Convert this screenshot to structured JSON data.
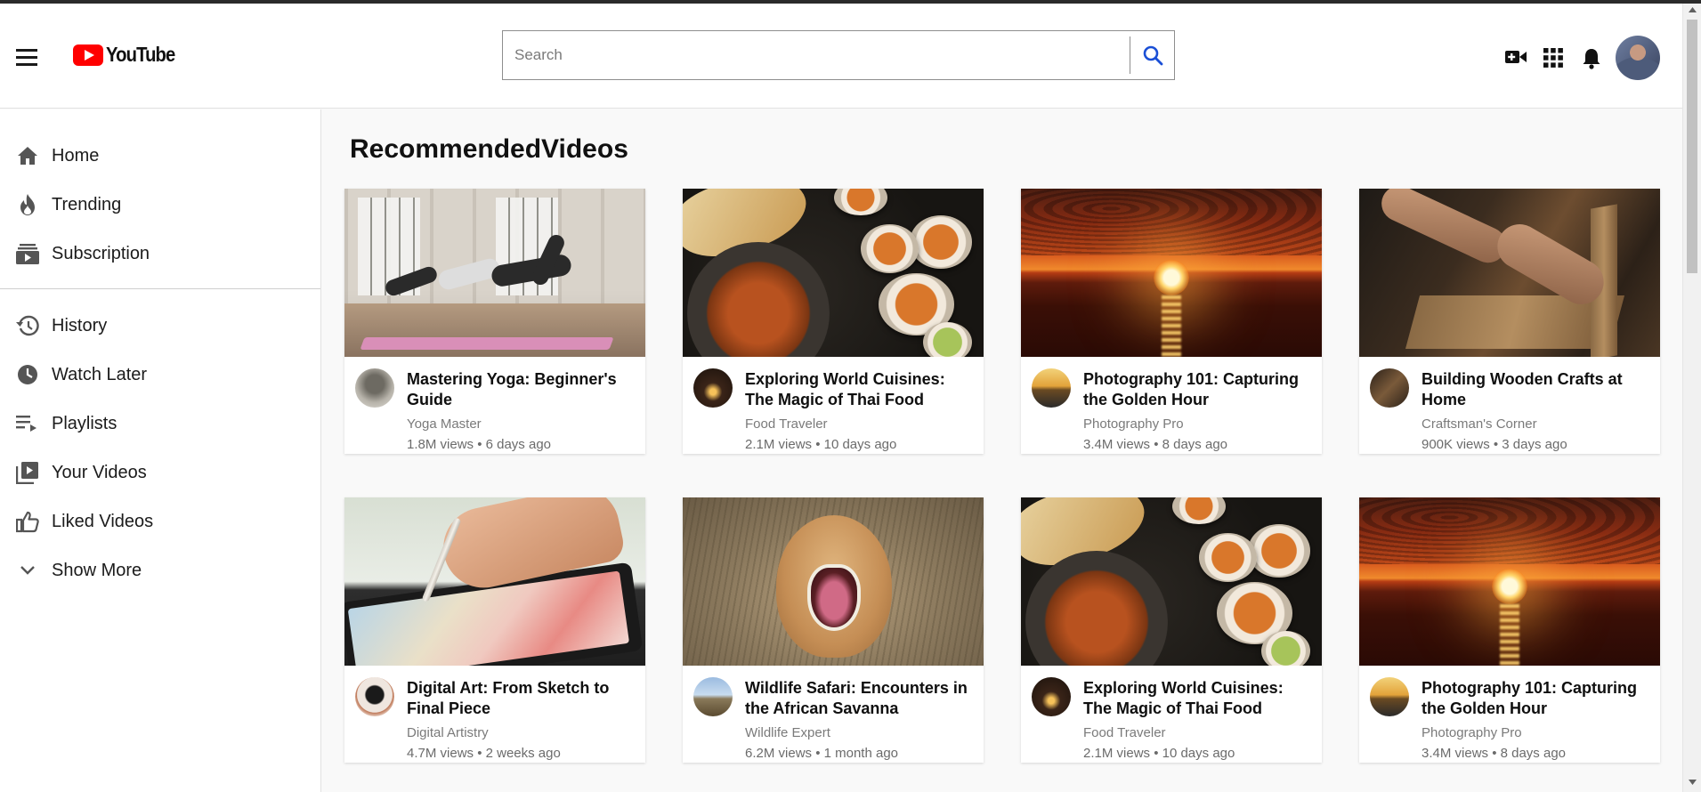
{
  "header": {
    "logo_text": "YouTube",
    "search_placeholder": "Search"
  },
  "sidebar": {
    "items": [
      {
        "label": "Home",
        "icon": "home-icon"
      },
      {
        "label": "Trending",
        "icon": "fire-icon"
      },
      {
        "label": "Subscription",
        "icon": "subscriptions-icon"
      },
      {
        "label": "History",
        "icon": "history-icon"
      },
      {
        "label": "Watch Later",
        "icon": "clock-icon"
      },
      {
        "label": "Playlists",
        "icon": "playlist-icon"
      },
      {
        "label": "Your Videos",
        "icon": "your-videos-icon"
      },
      {
        "label": "Liked Videos",
        "icon": "thumbs-up-icon"
      },
      {
        "label": "Show More",
        "icon": "chevron-down-icon"
      }
    ]
  },
  "main": {
    "title": "RecommendedVideos",
    "videos": [
      {
        "title": "Mastering Yoga: Beginner's Guide",
        "channel": "Yoga Master",
        "meta": "1.8M views • 6 days ago"
      },
      {
        "title": "Exploring World Cuisines: The Magic of Thai Food",
        "channel": "Food Traveler",
        "meta": "2.1M views • 10 days ago"
      },
      {
        "title": "Photography 101: Capturing the Golden Hour",
        "channel": "Photography Pro",
        "meta": "3.4M views • 8 days ago"
      },
      {
        "title": "Building Wooden Crafts at Home",
        "channel": "Craftsman's Corner",
        "meta": "900K views • 3 days ago"
      },
      {
        "title": "Digital Art: From Sketch to Final Piece",
        "channel": "Digital Artistry",
        "meta": "4.7M views • 2 weeks ago"
      },
      {
        "title": "Wildlife Safari: Encounters in the African Savanna",
        "channel": "Wildlife Expert",
        "meta": "6.2M views • 1 month ago"
      },
      {
        "title": "Exploring World Cuisines: The Magic of Thai Food",
        "channel": "Food Traveler",
        "meta": "2.1M views • 10 days ago"
      },
      {
        "title": "Photography 101: Capturing the Golden Hour",
        "channel": "Photography Pro",
        "meta": "3.4M views • 8 days ago"
      }
    ]
  },
  "colors": {
    "brand_red": "#ff0000",
    "search_icon": "#1a4fd6",
    "text_primary": "#0f0f0f",
    "text_secondary": "#7a7a7a"
  }
}
